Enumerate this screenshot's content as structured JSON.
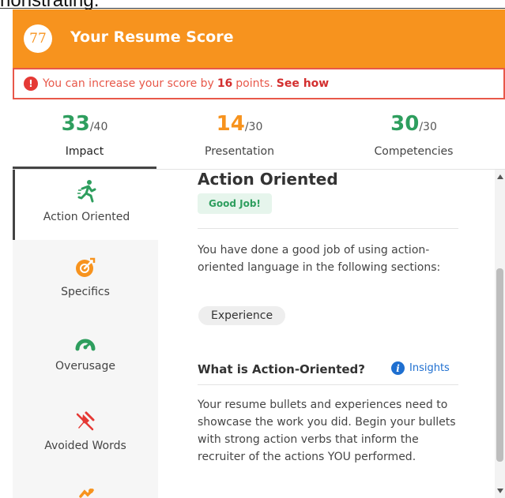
{
  "caption": "nonstrating.",
  "header": {
    "score": "77",
    "title": "Your Resume Score",
    "color": "#f7931e"
  },
  "alert": {
    "icon": "alert-circle-icon",
    "prefix": "You can increase your score by",
    "points": "16",
    "suffix": "points.",
    "link": "See how",
    "color": "#e8584a"
  },
  "tabs": [
    {
      "score": "33",
      "den": "/40",
      "label": "Impact",
      "active": true,
      "color": "#2e9e5e"
    },
    {
      "score": "14",
      "den": "/30",
      "label": "Presentation",
      "active": false,
      "color": "#f7931e"
    },
    {
      "score": "30",
      "den": "/30",
      "label": "Competencies",
      "active": false,
      "color": "#2e9e5e"
    }
  ],
  "sidebar": {
    "items": [
      {
        "label": "Action Oriented",
        "icon": "action-runner-icon",
        "active": true,
        "color": "#2e9e5e"
      },
      {
        "label": "Specifics",
        "icon": "target-icon",
        "active": false,
        "color": "#f7931e"
      },
      {
        "label": "Overusage",
        "icon": "gauge-icon",
        "active": false,
        "color": "#2e9e5e"
      },
      {
        "label": "Avoided Words",
        "icon": "pin-slash-icon",
        "active": false,
        "color": "#e53935"
      },
      {
        "label": "",
        "icon": "partial-icon",
        "active": false,
        "color": "#f7931e"
      }
    ]
  },
  "content": {
    "title": "Action Oriented",
    "badge": "Good Job!",
    "paragraph1": "You have done a good job of using action-oriented language in the following sections:",
    "pill": "Experience",
    "heading2": "What is Action-Oriented?",
    "insights_label": "Insights",
    "paragraph2": "Your resume bullets and experiences need to showcase the work you did. Begin your bullets with strong action verbs that inform the recruiter of the actions YOU performed."
  }
}
